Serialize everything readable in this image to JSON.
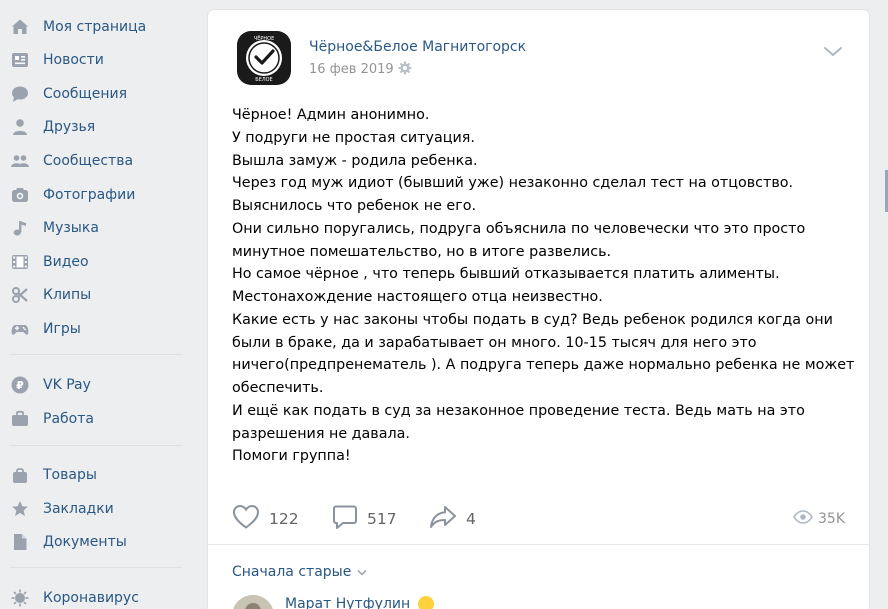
{
  "sidebar": {
    "items": [
      {
        "label": "Моя страница",
        "icon": "home-icon"
      },
      {
        "label": "Новости",
        "icon": "news-icon"
      },
      {
        "label": "Сообщения",
        "icon": "messages-icon"
      },
      {
        "label": "Друзья",
        "icon": "friends-icon"
      },
      {
        "label": "Сообщества",
        "icon": "groups-icon"
      },
      {
        "label": "Фотографии",
        "icon": "photos-icon"
      },
      {
        "label": "Музыка",
        "icon": "music-icon"
      },
      {
        "label": "Видео",
        "icon": "video-icon"
      },
      {
        "label": "Клипы",
        "icon": "clips-icon"
      },
      {
        "label": "Игры",
        "icon": "games-icon"
      },
      {
        "label": "VK Pay",
        "icon": "vkpay-icon"
      },
      {
        "label": "Работа",
        "icon": "work-icon"
      },
      {
        "label": "Товары",
        "icon": "market-icon"
      },
      {
        "label": "Закладки",
        "icon": "bookmarks-icon"
      },
      {
        "label": "Документы",
        "icon": "documents-icon"
      },
      {
        "label": "Коронавирус",
        "icon": "coronavirus-icon"
      }
    ]
  },
  "post": {
    "author": "Чёрное&Белое Магнитогорск",
    "avatar_text": "ЧЁРНОЕ БЕЛОЕ",
    "date": "16 фев 2019",
    "lines": [
      "Чёрное! Админ анонимно.",
      "У подруги не простая ситуация.",
      "Вышла замуж - родила ребенка.",
      "Через год муж идиот (бывший уже) незаконно сделал тест на отцовство.",
      "Выяснилось что ребенок не его.",
      "Они сильно поругались, подруга объяснила по человечески что это просто",
      "минутное помешательство, но в итоге развелись.",
      "Но самое чёрное , что теперь бывший отказывается платить алименты.",
      "Местонахождение настоящего отца неизвестно.",
      "Какие есть у нас законы чтобы подать в суд? Ведь ребенок родился когда они",
      "были в браке, да и зарабатывает он много. 10-15 тысяч для него это",
      "ничего(предпренематель ). А подруга теперь даже нормально ребенка не может",
      "обеспечить.",
      "И ещё как подать в суд за незаконное проведение теста. Ведь мать на это",
      "разрешения не давала.",
      "Помоги группа!"
    ],
    "likes": "122",
    "comments": "517",
    "shares": "4",
    "views": "35K"
  },
  "comments_section": {
    "sort_label": "Сначала старые",
    "first_comment_author": "Марат Нутфулин"
  },
  "colors": {
    "link": "#2a5885",
    "icon": "#99a2ad",
    "background": "#edeef0"
  }
}
